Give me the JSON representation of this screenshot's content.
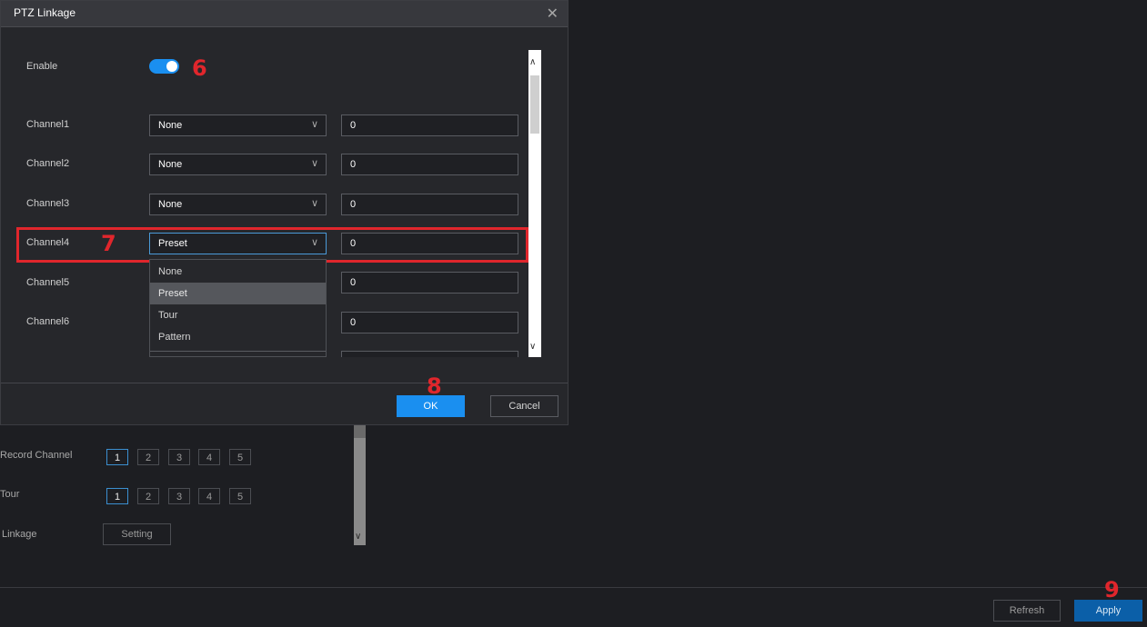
{
  "dialog": {
    "title": "PTZ Linkage",
    "enable_label": "Enable",
    "enable_on": true,
    "channels": [
      {
        "label": "Channel1",
        "mode": "None",
        "value": "0"
      },
      {
        "label": "Channel2",
        "mode": "None",
        "value": "0"
      },
      {
        "label": "Channel3",
        "mode": "None",
        "value": "0"
      },
      {
        "label": "Channel4",
        "mode": "Preset",
        "value": "0"
      },
      {
        "label": "Channel5",
        "mode": "",
        "value": "0"
      },
      {
        "label": "Channel6",
        "mode": "",
        "value": "0"
      }
    ],
    "dropdown_options": [
      "None",
      "Preset",
      "Tour",
      "Pattern"
    ],
    "dropdown_selected": "Preset",
    "ok_label": "OK",
    "cancel_label": "Cancel"
  },
  "background": {
    "record_channel_label": "Record Channel",
    "record_channel_options": [
      "1",
      "2",
      "3",
      "4",
      "5"
    ],
    "record_channel_active": "1",
    "tour_label": "Tour",
    "tour_options": [
      "1",
      "2",
      "3",
      "4",
      "5"
    ],
    "tour_active": "1",
    "linkage_label": "Linkage",
    "setting_label": "Setting"
  },
  "footer": {
    "refresh_label": "Refresh",
    "apply_label": "Apply"
  },
  "annotations": {
    "step6": "6",
    "step7": "7",
    "step8": "8",
    "step9": "9",
    "color": "#e0262c"
  },
  "colors": {
    "accent": "#1a8ff0",
    "apply": "#0b5fa8"
  }
}
